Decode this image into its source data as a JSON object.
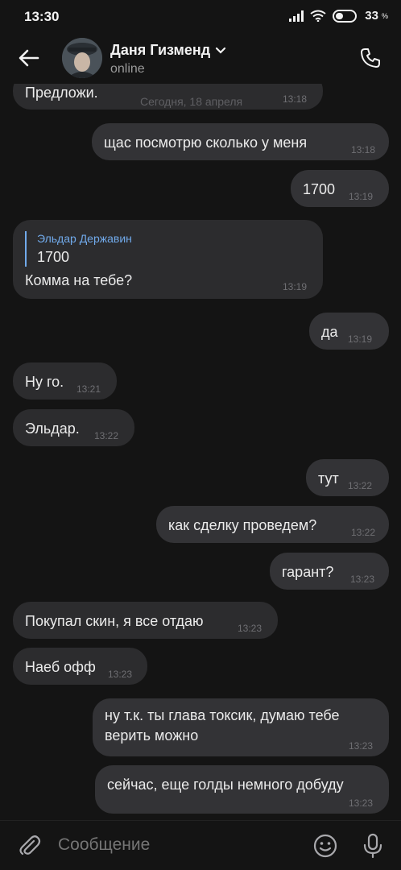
{
  "status_bar": {
    "time": "13:30",
    "battery_percent": "33",
    "percent_sign": "%"
  },
  "header": {
    "contact_name": "Даня Гизменд",
    "contact_status": "online"
  },
  "date_separator": "Сегодня, 18 апреля",
  "messages": [
    {
      "direction": "in",
      "text": "Предложи.",
      "time": "13:18"
    },
    {
      "direction": "out",
      "text": "щас посмотрю сколько у меня",
      "time": "13:18"
    },
    {
      "direction": "out",
      "text": "1700",
      "time": "13:19"
    },
    {
      "direction": "in",
      "reply_author": "Эльдар Державин",
      "reply_text": "1700",
      "text": "Комма на тебе?",
      "time": "13:19"
    },
    {
      "direction": "out",
      "text": "да",
      "time": "13:19"
    },
    {
      "direction": "in",
      "text": "Ну го.",
      "time": "13:21"
    },
    {
      "direction": "in",
      "text": "Эльдар.",
      "time": "13:22"
    },
    {
      "direction": "out",
      "text": "тут",
      "time": "13:22"
    },
    {
      "direction": "out",
      "text": "как сделку проведем?",
      "time": "13:22"
    },
    {
      "direction": "out",
      "text": "гарант?",
      "time": "13:23"
    },
    {
      "direction": "in",
      "text": "Покупал скин, я все отдаю",
      "time": "13:23"
    },
    {
      "direction": "in",
      "text": "Наеб офф",
      "time": "13:23"
    },
    {
      "direction": "out",
      "text": "ну т.к. ты глава токсик, думаю тебе верить можно",
      "time": "13:23"
    },
    {
      "direction": "out",
      "text": "сейчас, еще голды немного добуду",
      "time": "13:23"
    }
  ],
  "composer": {
    "placeholder": "Сообщение"
  },
  "colors": {
    "background": "#141414",
    "bubble_in": "#2c2c2e",
    "bubble_out": "#333336",
    "accent": "#71aaeb"
  }
}
